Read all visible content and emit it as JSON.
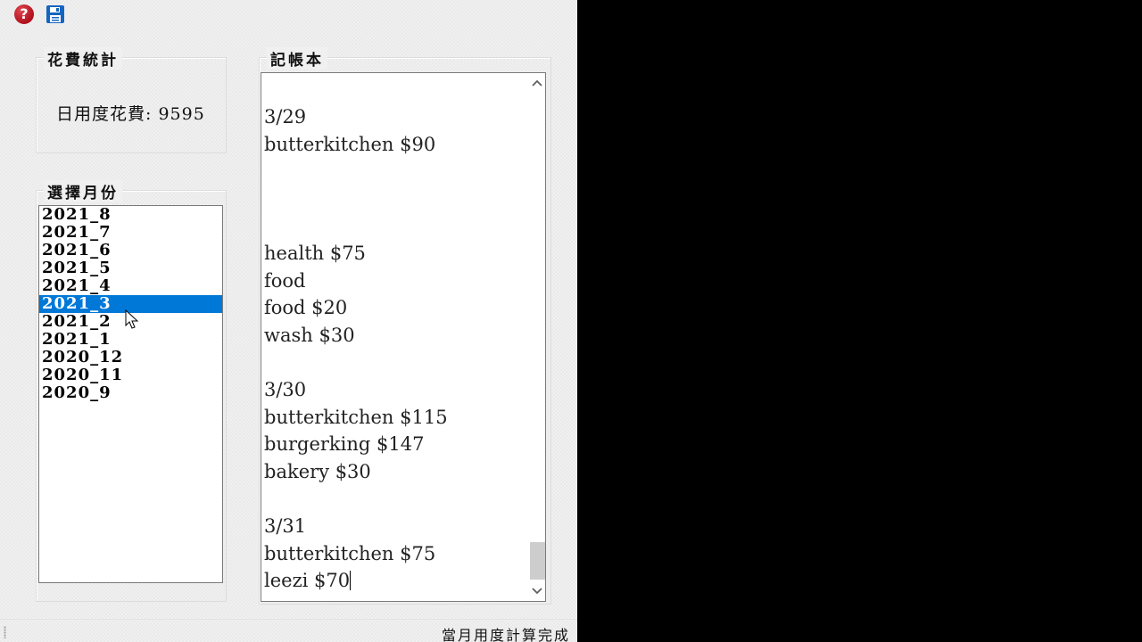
{
  "toolbar": {
    "help_icon_glyph": "?",
    "icons": [
      "help-icon",
      "save-icon"
    ]
  },
  "stats": {
    "title": "花費統計",
    "value_text": "日用度花費: 9595"
  },
  "months": {
    "title": "選擇月份",
    "items": [
      "2021_8",
      "2021_7",
      "2021_6",
      "2021_5",
      "2021_4",
      "2021_3",
      "2021_2",
      "2021_1",
      "2020_12",
      "2020_11",
      "2020_9"
    ],
    "selected": "2021_3"
  },
  "notebook": {
    "title": "記帳本",
    "lines": [
      "3/29",
      "butterkitchen $90",
      "",
      "",
      "",
      "health $75",
      "food",
      "food $20",
      "wash $30",
      "",
      "3/30",
      "butterkitchen $115",
      "burgerking $147",
      "bakery $30",
      "",
      "3/31",
      "butterkitchen $75",
      "leezi $70"
    ]
  },
  "status": {
    "text": "當月用度計算完成"
  },
  "colors": {
    "selection": "#0078d7",
    "help_red": "#c8141f",
    "save_blue": "#1565c0"
  }
}
